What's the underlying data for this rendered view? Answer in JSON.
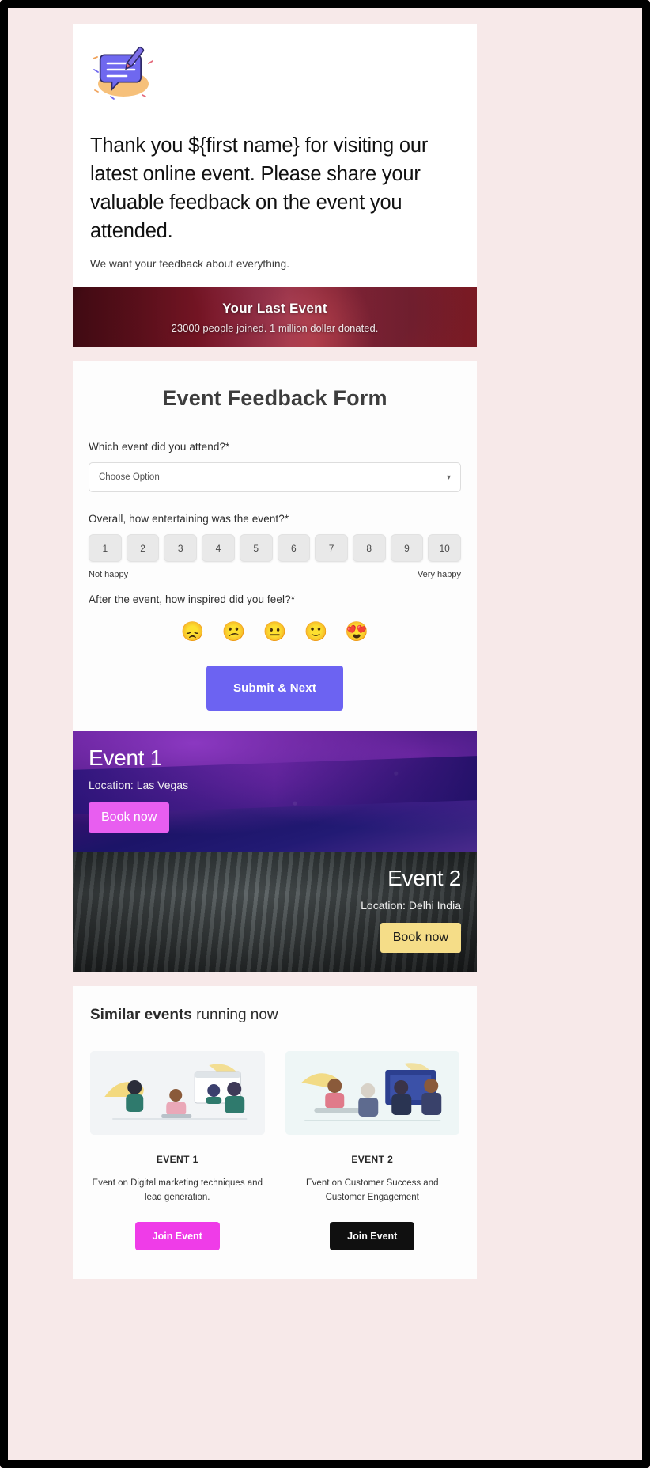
{
  "hero": {
    "icon": "feedback-chat-pencil-icon",
    "title": "Thank you ${first name} for visiting our latest online event. Please share your valuable feedback on the event you attended.",
    "subtitle": "We want your feedback about everything."
  },
  "banner": {
    "title": "Your Last Event",
    "subtitle": "23000 people joined. 1 million dollar donated."
  },
  "form": {
    "title": "Event Feedback Form",
    "q1_label": "Which event did you attend?*",
    "select_value": "Choose Option",
    "select_caret": "chevron-down-icon",
    "q2_label": "Overall, how entertaining was the event?*",
    "scale": [
      "1",
      "2",
      "3",
      "4",
      "5",
      "6",
      "7",
      "8",
      "9",
      "10"
    ],
    "scale_low": "Not happy",
    "scale_high": "Very happy",
    "q3_label": "After the event, how inspired did you feel?*",
    "emojis": [
      "😞",
      "😕",
      "😐",
      "🙂",
      "😍"
    ],
    "emoji_names": [
      "sad-face-icon",
      "confused-face-icon",
      "neutral-face-icon",
      "slight-smile-icon",
      "heart-eyes-icon"
    ],
    "submit_label": "Submit & Next"
  },
  "promos": [
    {
      "title": "Event 1",
      "location": "Location: Las Vegas",
      "button": "Book now"
    },
    {
      "title": "Event 2",
      "location": "Location: Delhi India",
      "button": "Book now"
    }
  ],
  "similar": {
    "heading_bold": "Similar events",
    "heading_rest": " running now",
    "cards": [
      {
        "name": "EVENT 1",
        "description": "Event on Digital marketing techniques and lead generation.",
        "button": "Join Event"
      },
      {
        "name": "EVENT 2",
        "description": "Event on Customer Success and Customer Engagement",
        "button": "Join Event"
      }
    ]
  },
  "colors": {
    "page_background": "#f7e9e9",
    "submit": "#6c63f2",
    "book_pink": "#e85ef0",
    "book_yellow": "#f5dd88",
    "join_magenta": "#ef3ce8",
    "join_black": "#101010"
  }
}
